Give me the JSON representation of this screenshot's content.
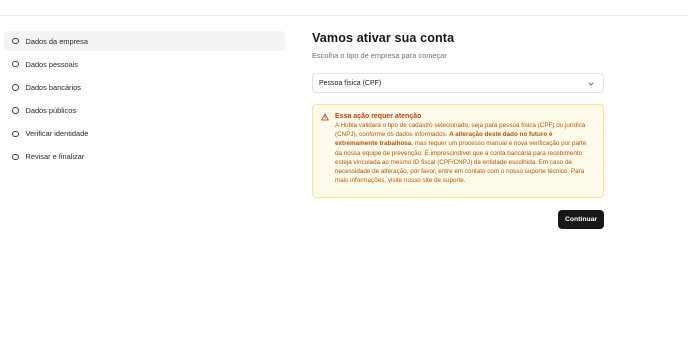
{
  "sidebar": {
    "steps": [
      {
        "label": "Dados da empresa"
      },
      {
        "label": "Dados pessoais"
      },
      {
        "label": "Dados bancários"
      },
      {
        "label": "Dados públicos"
      },
      {
        "label": "Verificar identidade"
      },
      {
        "label": "Revisar e finalizar"
      }
    ]
  },
  "main": {
    "title": "Vamos ativar sua conta",
    "subtitle": "Escolha o tipo de empresa para começar",
    "select": {
      "value": "Pessoa física (CPF)",
      "icon": "chevron-down-icon"
    },
    "alert": {
      "icon": "warning-triangle-icon",
      "title": "Essa ação requer atenção",
      "body_part1": "A Hubla validará o tipo de cadastro selecionado, seja para pessoa física (CPF) ou jurídica (CNPJ), conforme os dados informados. ",
      "body_bold": "A alteração deste dado no futuro é extremamente trabalhosa",
      "body_part2": ", mas requer um processo manual e nova verificação por parte da nossa equipe de prevenção. É imprescindível que a conta bancária para recebimento esteja vinculada ao mesmo ID fiscal (CPF/CNPJ) da entidade escolhida. Em caso de necessidade de alteração, por favor, entre em contato com o nosso suporte técnico. Para mais informações, visite nosso site de suporte."
    },
    "continue_label": "Continuar"
  },
  "colors": {
    "primary_button": "#18181b",
    "alert_background": "#fffbeb",
    "alert_border": "#fde68a",
    "alert_text": "#b45309"
  }
}
